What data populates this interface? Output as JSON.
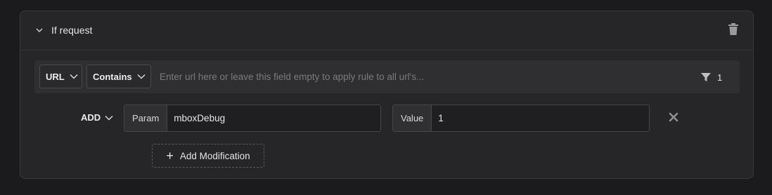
{
  "rule": {
    "title": "If request",
    "url_type": "URL",
    "match_type": "Contains",
    "url_placeholder": "Enter url here or leave this field empty to apply rule to all url's...",
    "url_value": "",
    "filter_count": "1"
  },
  "modification": {
    "action": "ADD",
    "param_label": "Param",
    "param_value": "mboxDebug",
    "value_label": "Value",
    "value_value": "1"
  },
  "add_modification_label": "Add Modification",
  "icons": {
    "collapse": "chevron-down-icon",
    "delete": "trash-icon",
    "filter": "filter-icon",
    "remove": "close-icon",
    "add": "plus-icon"
  }
}
